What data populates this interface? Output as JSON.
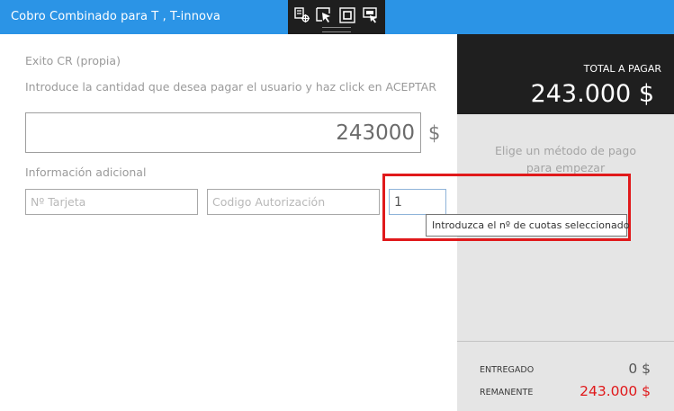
{
  "window": {
    "title": "Cobro Combinado para T , T-innova"
  },
  "devtools": {
    "icons": [
      "live-visual-tree-icon",
      "select-element-icon",
      "display-layout-adorners-icon",
      "track-focus-icon"
    ]
  },
  "form": {
    "payer_name": "Exito CR (propia)",
    "instructions": "Introduce la cantidad que desea pagar el usuario y haz click en ACEPTAR",
    "amount_value": "243000",
    "currency_symbol": "$",
    "extra_info_label": "Información adicional",
    "card_number_placeholder": "Nº Tarjeta",
    "auth_code_placeholder": "Codigo Autorización",
    "installments_value": "1",
    "installments_tooltip": "Introduzca el nº de cuotas seleccionado"
  },
  "summary": {
    "total_label": "TOTAL A PAGAR",
    "total_value": "243.000 $",
    "method_hint_line1": "Elige un método de pago",
    "method_hint_line2": "para empezar",
    "delivered_label": "ENTREGADO",
    "delivered_value": "0 $",
    "remaining_label": "REMANENTE",
    "remaining_value": "243.000 $"
  },
  "colors": {
    "titlebar": "#2b94e6",
    "dark_panel": "#1f1f1f",
    "side_panel": "#e5e5e5",
    "remaining": "#e0191b",
    "highlight_box": "#e0191b"
  }
}
